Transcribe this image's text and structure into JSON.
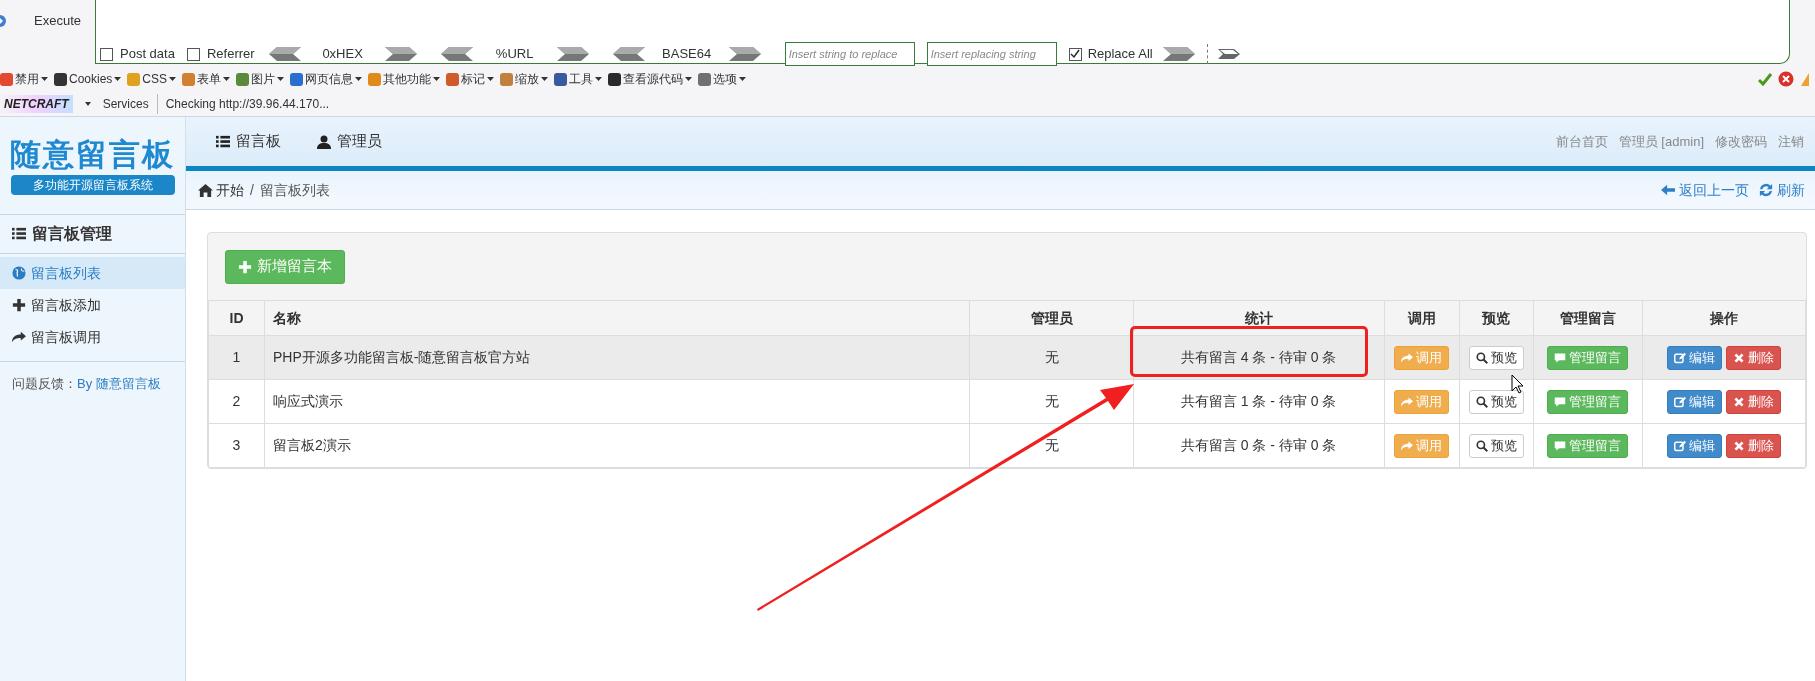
{
  "hackbar": {
    "execute_label": "Execute",
    "checkboxes": [
      {
        "label": "Post data",
        "checked": false
      },
      {
        "label": "Referrer",
        "checked": false
      }
    ],
    "encoders": [
      "0xHEX",
      "%URL",
      "BASE64"
    ],
    "replace_fields": [
      {
        "placeholder": "Insert string to replace"
      },
      {
        "placeholder": "Insert replacing string"
      }
    ],
    "replace_all": {
      "label": "Replace All",
      "checked": true
    }
  },
  "toolbar": {
    "menus": [
      {
        "label": "禁用",
        "color": "#e2492f"
      },
      {
        "label": "Cookies",
        "color": "#333333"
      },
      {
        "label": "CSS",
        "color": "#e0a020"
      },
      {
        "label": "表单",
        "color": "#d08030"
      },
      {
        "label": "图片",
        "color": "#5a8a3a"
      },
      {
        "label": "网页信息",
        "color": "#2a6fd0"
      },
      {
        "label": "其他功能",
        "color": "#e08a1a"
      },
      {
        "label": "标记",
        "color": "#d05a2a"
      },
      {
        "label": "缩放",
        "color": "#c08040"
      },
      {
        "label": "工具",
        "color": "#3a5aa0"
      },
      {
        "label": "查看源代码",
        "color": "#2a2a2a"
      },
      {
        "label": "选项",
        "color": "#707070"
      }
    ]
  },
  "netcraft_bar": {
    "logo": "NETCRAFT",
    "services": "Services",
    "status": "Checking http://39.96.44.170..."
  },
  "brand": {
    "title": "随意留言板",
    "subtitle": "多功能开源留言板系统"
  },
  "nav": [
    {
      "label": "留言板",
      "kind": "list"
    },
    {
      "label": "管理员",
      "kind": "user"
    }
  ],
  "top_links": [
    "前台首页",
    "管理员 [admin]",
    "修改密码",
    "注销"
  ],
  "breadcrumb": [
    "开始",
    "留言板列表"
  ],
  "breadcrumb_separator": "/",
  "page_actions": [
    {
      "label": "返回上一页",
      "kind": "back"
    },
    {
      "label": "刷新",
      "kind": "refresh"
    }
  ],
  "sidebar": {
    "heading": "留言板管理",
    "items": [
      {
        "label": "留言板列表",
        "kind": "globe",
        "selected": true
      },
      {
        "label": "留言板添加",
        "kind": "plus",
        "selected": false
      },
      {
        "label": "留言板调用",
        "kind": "share",
        "selected": false
      }
    ],
    "feedback_label": "问题反馈：",
    "feedback_link": "By 随意留言板"
  },
  "table": {
    "add_button": "新增留言本",
    "columns": [
      "ID",
      "名称",
      "管理员",
      "统计",
      "调用",
      "预览",
      "管理留言",
      "操作"
    ],
    "rows": [
      {
        "id": "1",
        "name": "PHP开源多功能留言板-随意留言板官方站",
        "admin": "无",
        "stats": "共有留言 4 条 - 待审 0 条",
        "highlighted": true,
        "actions": [
          "调用",
          "预览",
          "管理留言",
          "编辑",
          "删除"
        ]
      },
      {
        "id": "2",
        "name": "响应式演示",
        "admin": "无",
        "stats": "共有留言 1 条 - 待审 0 条",
        "highlighted": false,
        "actions": [
          "调用",
          "预览",
          "管理留言",
          "编辑",
          "删除"
        ]
      },
      {
        "id": "3",
        "name": "留言板2演示",
        "admin": "无",
        "stats": "共有留言 0 条 - 待审 0 条",
        "highlighted": false,
        "actions": [
          "调用",
          "预览",
          "管理留言",
          "编辑",
          "删除"
        ]
      }
    ]
  }
}
